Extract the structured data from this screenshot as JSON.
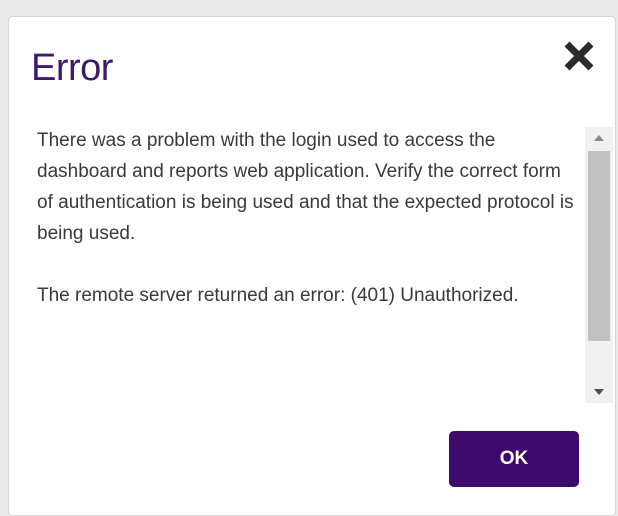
{
  "dialog": {
    "title": "Error",
    "close_icon": "close-icon",
    "message_paragraphs": [
      "There was a problem with the login used to access the dashboard and reports web application. Verify the correct form of authentication is being used and that the expected protocol is being used.",
      "The remote server returned an error: (401) Unauthorized."
    ],
    "ok_label": "OK"
  },
  "colors": {
    "title": "#3d1a6e",
    "button_bg": "#3d0a6b",
    "button_text": "#ffffff",
    "body_text": "#3a3a3a"
  }
}
